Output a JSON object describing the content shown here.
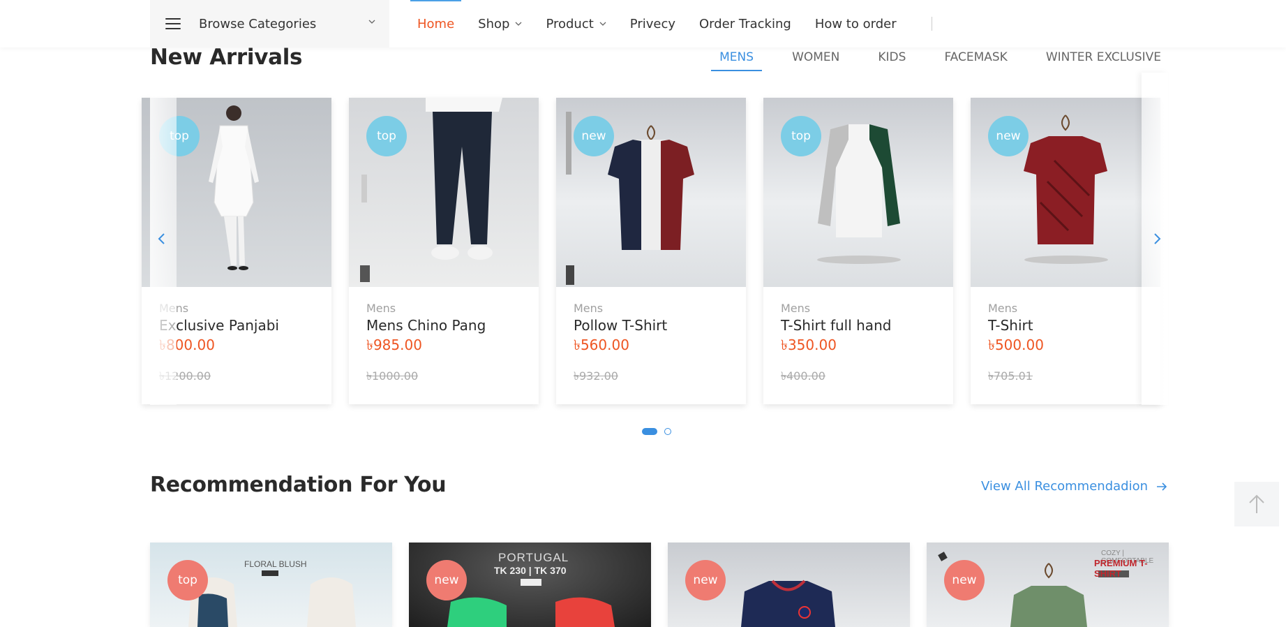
{
  "header": {
    "browse_label": "Browse Categories",
    "nav": [
      {
        "label": "Home",
        "active": true,
        "dropdown": false
      },
      {
        "label": "Shop",
        "active": false,
        "dropdown": true
      },
      {
        "label": "Product",
        "active": false,
        "dropdown": true
      },
      {
        "label": "Privecy",
        "active": false,
        "dropdown": false
      },
      {
        "label": "Order Tracking",
        "active": false,
        "dropdown": false
      },
      {
        "label": "How to order",
        "active": false,
        "dropdown": false
      }
    ]
  },
  "new_arrivals": {
    "title": "New Arrivals",
    "tabs": [
      "MENS",
      "WOMEN",
      "KIDS",
      "FACEMASK",
      "WINTER EXCLUSIVE"
    ],
    "active_tab": "MENS",
    "products": [
      {
        "badge": "top",
        "category": "Mens",
        "name": "Exclusive Panjabi",
        "price": "৳800.00",
        "old_price": "৳1200.00"
      },
      {
        "badge": "top",
        "category": "Mens",
        "name": "Mens Chino Pang",
        "price": "৳985.00",
        "old_price": "৳1000.00"
      },
      {
        "badge": "new",
        "category": "Mens",
        "name": "Pollow T-Shirt",
        "price": "৳560.00",
        "old_price": "৳932.00"
      },
      {
        "badge": "top",
        "category": "Mens",
        "name": "T-Shirt full hand",
        "price": "৳350.00",
        "old_price": "৳400.00"
      },
      {
        "badge": "new",
        "category": "Mens",
        "name": "T-Shirt",
        "price": "৳500.00",
        "old_price": "৳705.01"
      }
    ],
    "page_count": 2,
    "current_page": 1
  },
  "recommendation": {
    "title": "Recommendation For You",
    "view_all": "View All Recommendadion",
    "items": [
      {
        "badge": "top",
        "image_text": "FLORAL BLUSH"
      },
      {
        "badge": "new",
        "image_text": "PORTUGAL",
        "image_text2": "TK 230 | TK 370"
      },
      {
        "badge": "new"
      },
      {
        "badge": "new",
        "image_text": "COZY | COMFORTABLE",
        "image_text2": "PREMIUM T-SHIRT"
      }
    ]
  },
  "colors": {
    "accent_blue": "#3a8fe0",
    "price_orange": "#ee5522",
    "badge_top": "#7ccde6",
    "badge_red": "#ef7b71"
  },
  "icons": {
    "menu": "hamburger-icon",
    "chevron": "chevron-down-icon",
    "prev": "chevron-left-icon",
    "next": "chevron-right-icon",
    "arrow": "arrow-right-icon",
    "to_top": "arrow-up-icon"
  }
}
